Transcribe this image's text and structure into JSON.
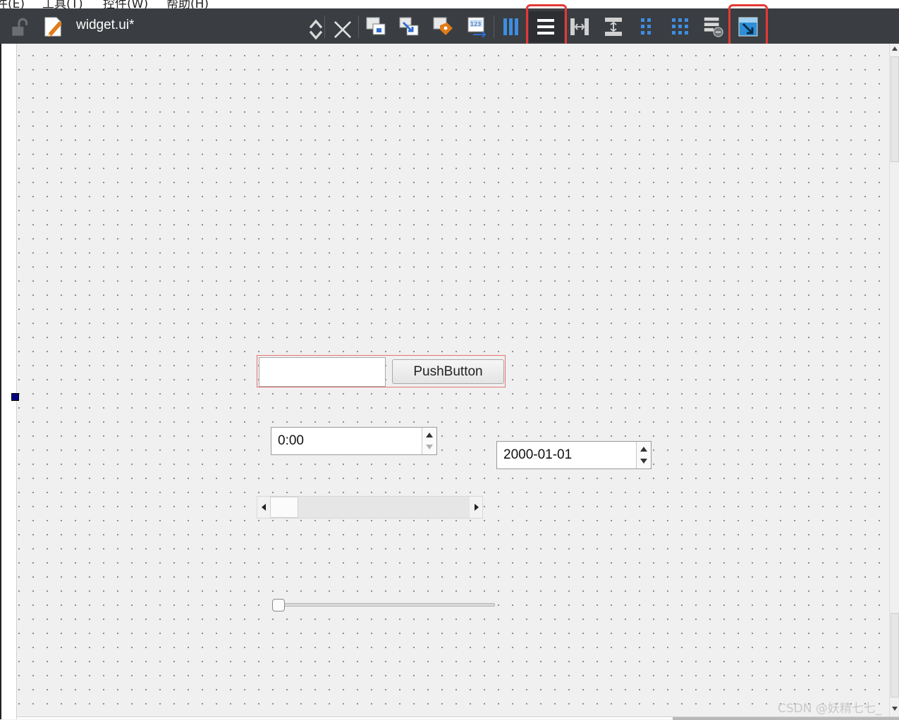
{
  "menu": {
    "items": [
      "件(E)",
      "工具(T)",
      "控件(W)",
      "帮助(H)"
    ]
  },
  "toolbar": {
    "file_name": "widget.ui*",
    "icons": [
      "lock-icon",
      "edit-file-icon",
      "switch-updown-icon",
      "close-icon",
      "edit-widgets-icon",
      "edit-signals-slots-icon",
      "edit-buddies-icon",
      "edit-tab-order-icon",
      "layout-horizontal-icon",
      "layout-vertical-icon",
      "layout-horizontal-splitter-icon",
      "layout-vertical-splitter-icon",
      "layout-form-icon",
      "layout-grid-icon",
      "break-layout-icon",
      "adjust-size-icon"
    ],
    "highlighted": [
      "layout-vertical-icon",
      "adjust-size-icon"
    ],
    "highlight_color": "#e53935"
  },
  "form": {
    "push_button_label": "PushButton",
    "line_edit_value": "",
    "time_edit_value": "0:00",
    "date_edit_value": "2000-01-01",
    "scrollbar_position": 0.0,
    "slider_position": 0.0
  },
  "watermark": "CSDN @妖精七七_"
}
